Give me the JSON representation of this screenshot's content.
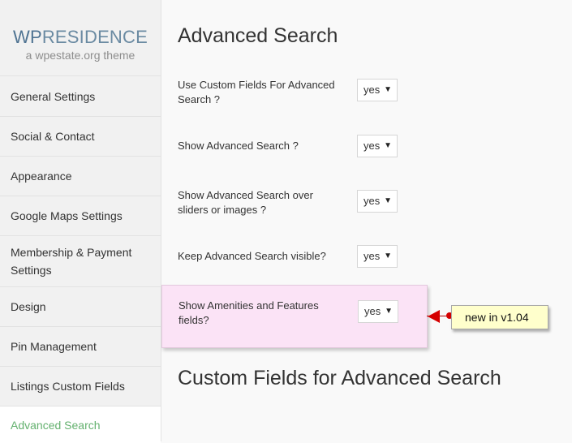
{
  "logo": {
    "brand_wp": "WP",
    "brand_rest": "RESIDENCE",
    "tagline": "a wpestate.org theme"
  },
  "sidebar": {
    "items": [
      {
        "label": "General Settings"
      },
      {
        "label": "Social & Contact"
      },
      {
        "label": "Appearance"
      },
      {
        "label": "Google Maps Settings"
      },
      {
        "label": "Membership & Payment Settings"
      },
      {
        "label": "Design"
      },
      {
        "label": "Pin Management"
      },
      {
        "label": "Listings Custom Fields"
      },
      {
        "label": "Advanced Search",
        "active": true
      }
    ]
  },
  "main": {
    "title": "Advanced Search",
    "settings": [
      {
        "label": "Use Custom Fields For Advanced Search ?",
        "value": "yes"
      },
      {
        "label": "Show Advanced Search ?",
        "value": "yes"
      },
      {
        "label": "Show Advanced Search over sliders or images ?",
        "value": "yes"
      },
      {
        "label": "Keep Advanced Search visible?",
        "value": "yes"
      },
      {
        "label": "Show Amenities and Features fields?",
        "value": "yes"
      }
    ],
    "section2_title": "Custom Fields for Advanced Search"
  },
  "annotation": {
    "text": "new in v1.04"
  },
  "colors": {
    "active_menu": "#64b16f",
    "highlight_bg": "#fbe3f6",
    "note_bg": "#ffffcc",
    "arrow": "#d50000"
  },
  "icons": {
    "select_arrow": "caret-down-icon"
  }
}
